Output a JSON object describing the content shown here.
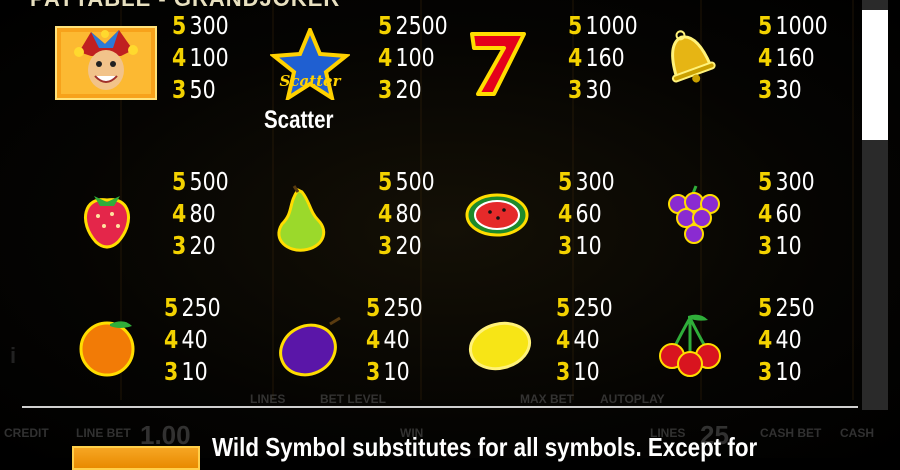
{
  "header": {
    "title": "PAYTABLE - GRANDJOKER"
  },
  "symbols": [
    {
      "name": "joker",
      "pays": [
        {
          "count": "5",
          "amount": "300"
        },
        {
          "count": "4",
          "amount": "100"
        },
        {
          "count": "3",
          "amount": "50"
        }
      ]
    },
    {
      "name": "scatter",
      "label": "Scatter",
      "pays": [
        {
          "count": "5",
          "amount": "2500"
        },
        {
          "count": "4",
          "amount": "100"
        },
        {
          "count": "3",
          "amount": "20"
        }
      ]
    },
    {
      "name": "seven",
      "pays": [
        {
          "count": "5",
          "amount": "1000"
        },
        {
          "count": "4",
          "amount": "160"
        },
        {
          "count": "3",
          "amount": "30"
        }
      ]
    },
    {
      "name": "bell",
      "pays": [
        {
          "count": "5",
          "amount": "1000"
        },
        {
          "count": "4",
          "amount": "160"
        },
        {
          "count": "3",
          "amount": "30"
        }
      ]
    },
    {
      "name": "strawberry",
      "pays": [
        {
          "count": "5",
          "amount": "500"
        },
        {
          "count": "4",
          "amount": "80"
        },
        {
          "count": "3",
          "amount": "20"
        }
      ]
    },
    {
      "name": "pear",
      "pays": [
        {
          "count": "5",
          "amount": "500"
        },
        {
          "count": "4",
          "amount": "80"
        },
        {
          "count": "3",
          "amount": "20"
        }
      ]
    },
    {
      "name": "watermelon",
      "pays": [
        {
          "count": "5",
          "amount": "300"
        },
        {
          "count": "4",
          "amount": "60"
        },
        {
          "count": "3",
          "amount": "10"
        }
      ]
    },
    {
      "name": "grapes",
      "pays": [
        {
          "count": "5",
          "amount": "300"
        },
        {
          "count": "4",
          "amount": "60"
        },
        {
          "count": "3",
          "amount": "10"
        }
      ]
    },
    {
      "name": "orange",
      "pays": [
        {
          "count": "5",
          "amount": "250"
        },
        {
          "count": "4",
          "amount": "40"
        },
        {
          "count": "3",
          "amount": "10"
        }
      ]
    },
    {
      "name": "plum",
      "pays": [
        {
          "count": "5",
          "amount": "250"
        },
        {
          "count": "4",
          "amount": "40"
        },
        {
          "count": "3",
          "amount": "10"
        }
      ]
    },
    {
      "name": "lemon",
      "pays": [
        {
          "count": "5",
          "amount": "250"
        },
        {
          "count": "4",
          "amount": "40"
        },
        {
          "count": "3",
          "amount": "10"
        }
      ]
    },
    {
      "name": "cherries",
      "pays": [
        {
          "count": "5",
          "amount": "250"
        },
        {
          "count": "4",
          "amount": "40"
        },
        {
          "count": "3",
          "amount": "10"
        }
      ]
    }
  ],
  "description": "Wild Symbol substitutes for all symbols. Except for",
  "background_labels": {
    "lines": "LINES",
    "bet_level": "BET LEVEL",
    "max_bet": "MAX BET",
    "autoplay": "AUTOPLAY",
    "credit": "CREDIT",
    "line_bet": "LINE BET",
    "line_bet_value": "1.00",
    "win": "WIN",
    "lines_bottom": "LINES",
    "lines_value": "25",
    "cash_bet": "CASH BET",
    "cash": "CASH"
  },
  "colors": {
    "count": "#f3d200",
    "amount": "#ffffff",
    "background": "#000000"
  }
}
